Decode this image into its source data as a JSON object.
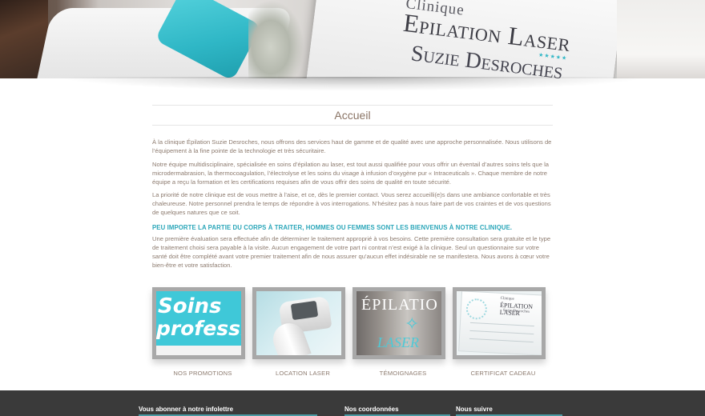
{
  "hero": {
    "brand_line1": "Clinique",
    "brand_line2": "Epilation Laser",
    "brand_stars": "★★★★★",
    "brand_line3": "Suzie Desroches"
  },
  "page_title": "Accueil",
  "paragraphs": [
    "À la clinique Épilation Suzie Desroches, nous offrons des services haut de gamme et de qualité avec une approche personnalisée. Nous utilisons de l’équipement à la fine pointe de la technologie et très sécuritaire.",
    "Notre équipe multidisciplinaire, spécialisée en soins d’épilation au laser, est tout aussi qualifiée pour vous offrir un éventail d’autres soins tels que la microdermabrasion, la thermocoagulation, l’électrolyse et les soins du visage à infusion d’oxygène pur « Intraceuticals ». Chaque membre de notre équipe a reçu la formation et les certifications requises afin de vous offrir des soins de qualité en toute sécurité.",
    "La priorité de notre clinique est de vous mettre à l’aise, et ce, dès le premier contact. Vous serez accueilli(e)s dans une ambiance confortable et très chaleureuse. Notre personnel prendra le temps de répondre à vos interrogations. N’hésitez pas à nous faire part de vos craintes et de vos questions de quelques natures que ce soit."
  ],
  "highlight": "PEU IMPORTE LA PARTIE DU CORPS À TRAITER, HOMMES OU FEMMES SONT LES BIENVENUS À NOTRE CLINIQUE.",
  "paragraph_final": "Une première évaluation sera effectuée afin de déterminer le traitement approprié à vos besoins. Cette première consultation sera gratuite et le type de traitement choisi sera payable à la visite. Aucun engagement de votre part ni contrat n’est exigé à la clinique. Seul un questionnaire sur votre santé doit être complété avant votre premier traitement afin de nous assurer qu’aucun effet indésirable ne se manifestera. Nous avons à cœur votre bien-être et votre satisfaction.",
  "tiles": [
    {
      "label": "NOS PROMOTIONS",
      "image_text_1": "Soins",
      "image_text_2": "professi"
    },
    {
      "label": "LOCATION LASER"
    },
    {
      "label": "TÉMOIGNAGES",
      "image_text_1": "ÉPILATIO",
      "image_text_2": "LASER"
    },
    {
      "label": "CERTIFICAT CADEAU",
      "image_text_1": "Clinique",
      "image_text_2": "ÉPILATION LASER",
      "image_text_3": "Suzie Desroches"
    }
  ],
  "footer": {
    "newsletter_heading": "Vous abonner à notre infolettre",
    "contact_heading": "Nos coordonnées",
    "follow_heading": "Nous suivre"
  },
  "colors": {
    "accent": "#2aa6b9",
    "text": "#8d7b6f",
    "footer_bg": "#3a3a3a"
  }
}
